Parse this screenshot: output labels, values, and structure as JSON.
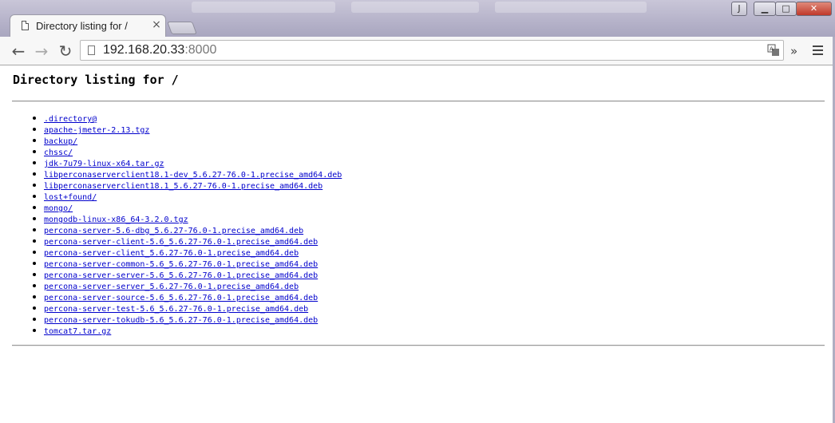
{
  "browser": {
    "tab": {
      "title": "Directory listing for /",
      "close_glyph": "×"
    },
    "toolbar": {
      "back_glyph": "←",
      "forward_glyph": "→",
      "reload_glyph": "↻",
      "url_host": "192.168.20.33",
      "url_port": ":8000",
      "extensions_glyph": "»"
    },
    "window_controls": {
      "user_glyph": "J",
      "minimize_glyph": "▁",
      "maximize_glyph": "□",
      "close_glyph": "✕"
    },
    "icons": {
      "tab": "page-icon",
      "omnibox": "page-icon",
      "translate": "translate-icon",
      "menu": "hamburger-menu-icon"
    }
  },
  "page": {
    "title": "Directory listing for /",
    "entries": [
      ".directory@",
      "apache-jmeter-2.13.tgz",
      "backup/",
      "chssc/",
      "jdk-7u79-linux-x64.tar.gz",
      "libperconaserverclient18.1-dev_5.6.27-76.0-1.precise_amd64.deb",
      "libperconaserverclient18.1_5.6.27-76.0-1.precise_amd64.deb",
      "lost+found/",
      "mongo/",
      "mongodb-linux-x86_64-3.2.0.tgz",
      "percona-server-5.6-dbg_5.6.27-76.0-1.precise_amd64.deb",
      "percona-server-client-5.6_5.6.27-76.0-1.precise_amd64.deb",
      "percona-server-client_5.6.27-76.0-1.precise_amd64.deb",
      "percona-server-common-5.6_5.6.27-76.0-1.precise_amd64.deb",
      "percona-server-server-5.6_5.6.27-76.0-1.precise_amd64.deb",
      "percona-server-server_5.6.27-76.0-1.precise_amd64.deb",
      "percona-server-source-5.6_5.6.27-76.0-1.precise_amd64.deb",
      "percona-server-test-5.6_5.6.27-76.0-1.precise_amd64.deb",
      "percona-server-tokudb-5.6_5.6.27-76.0-1.precise_amd64.deb",
      "tomcat7.tar.gz"
    ]
  }
}
